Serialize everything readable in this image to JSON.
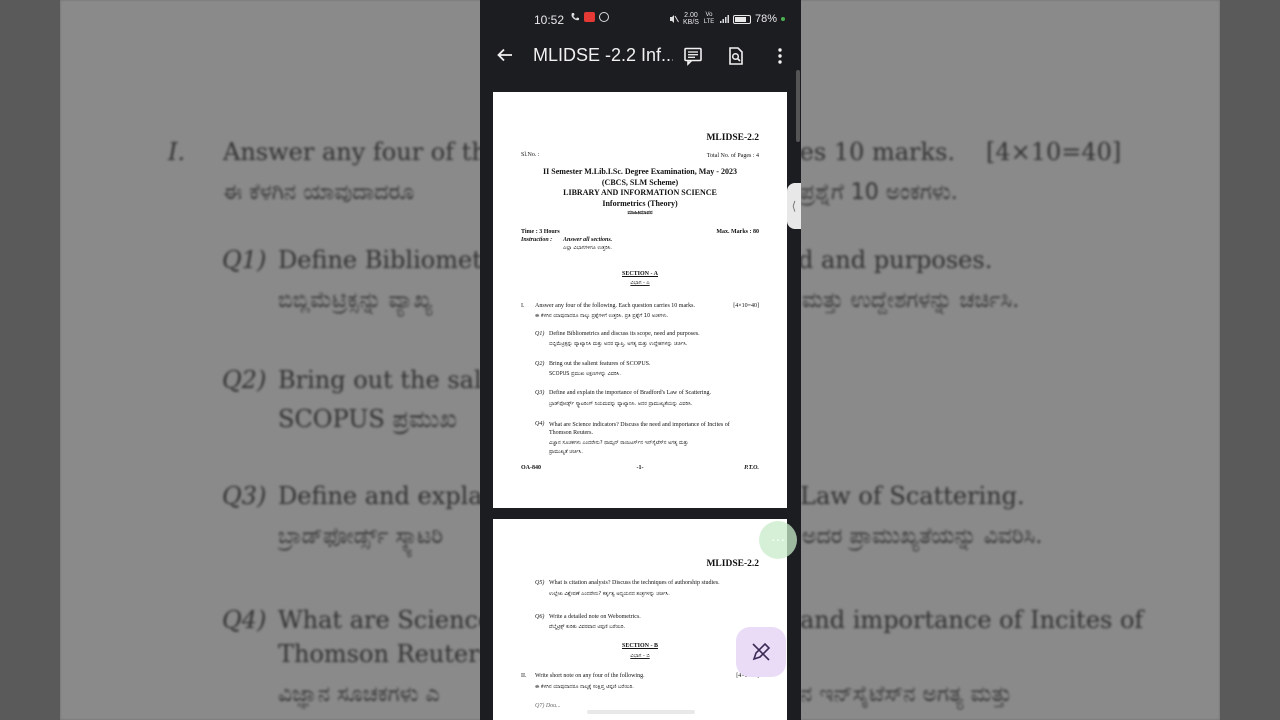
{
  "background": {
    "lines": [
      {
        "text": "I.",
        "kind": "q"
      },
      {
        "text": "Answer any four of the",
        "kind": "en"
      },
      {
        "text": "ies 10 marks.",
        "kind": "en"
      },
      {
        "text": "[4×10=40]",
        "kind": "en"
      },
      {
        "text": "ಈ ಕೆಳಗಿನ ಯಾವುದಾದರೂ",
        "kind": "kn"
      },
      {
        "text": "ಪ್ರಶ್ನೆಗೆ 10 ಅಂಕಗಳು.",
        "kind": "kn"
      },
      {
        "text": "Q1)",
        "kind": "q"
      },
      {
        "text": "Define Bibliometr",
        "kind": "en"
      },
      {
        "text": "d and purposes.",
        "kind": "en"
      },
      {
        "text": "ಬಿಬ್ಲಿಮೆಟ್ರಿಕ್ಸನ್ನು ವ್ಯಾಖ್ಯ",
        "kind": "kn"
      },
      {
        "text": "ಮತ್ತು ಉದ್ದೇಶಗಳನ್ನು ಚರ್ಚಿಸಿ.",
        "kind": "kn"
      },
      {
        "text": "Q2)",
        "kind": "q"
      },
      {
        "text": "Bring out the salie",
        "kind": "en"
      },
      {
        "text": "SCOPUS ಪ್ರಮುಖ",
        "kind": "en"
      },
      {
        "text": "Q3)",
        "kind": "q"
      },
      {
        "text": "Define and explai",
        "kind": "en"
      },
      {
        "text": "Law of Scattering.",
        "kind": "en"
      },
      {
        "text": "ಬ್ರಾಡ್‌ಫೋರ್ಡ್ಸ್ ಸ್ಕ್ಯಾಟರಿ",
        "kind": "kn"
      },
      {
        "text": "ಅದರ ಪ್ರಾಮುಖ್ಯತೆಯನ್ನು ವಿವರಿಸಿ.",
        "kind": "kn"
      },
      {
        "text": "Q4)",
        "kind": "q"
      },
      {
        "text": "What are Science",
        "kind": "en"
      },
      {
        "text": "and importance of Incites of",
        "kind": "en"
      },
      {
        "text": "Thomson Reuters.",
        "kind": "en"
      },
      {
        "text": "ವಿಜ್ಞಾನ ಸೂಚಕಗಳು ಎ",
        "kind": "kn"
      },
      {
        "text": "ನ ಇನ್‌ಸೈಟೆಸ್‌ನ ಅಗತ್ಯ ಮತ್ತು",
        "kind": "kn"
      }
    ]
  },
  "status_bar": {
    "time": "10:52",
    "speed_top": "2.00",
    "speed_bottom": "KB/S",
    "network": "Vo LTE",
    "battery": "78%",
    "battery_level": 0.78
  },
  "app_bar": {
    "title": "MLIDSE -2.2 Inf...",
    "back_icon": "arrow-back-icon",
    "comment_icon": "comment-icon",
    "search_icon": "find-in-page-icon",
    "menu_icon": "more-vert-icon"
  },
  "page1": {
    "code": "MLIDSE-2.2",
    "sl_no": "Sl.No. :",
    "total_pages": "Total No. of Pages : 4",
    "exam_line": "II Semester M.Lib.I.Sc. Degree Examination, May - 2023",
    "scheme": "(CBCS, SLM Scheme)",
    "subject": "LIBRARY AND INFORMATION SCIENCE",
    "paper": "Informetrics (Theory)",
    "paper_kn": "ಮಾಹಿತಿಮಾಪನ",
    "time": "Time : 3 Hours",
    "max_marks": "Max. Marks : 80",
    "instruction_label": "Instruction :",
    "instruction": "Answer all sections.",
    "instruction_kn": "ಎಲ್ಲಾ ವಿಭಾಗಗಳಿಗೂ ಉತ್ತರಿಸಿ.",
    "section_a": "SECTION - A",
    "section_a_kn": "ವಿಭಾಗ - ಎ",
    "part_no": "I.",
    "part_text": "Answer any four of the following. Each question carries 10 marks.",
    "part_marks": "[4×10=40]",
    "part_kn": "ಈ ಕೆಳಗಿನ ಯಾವುದಾದರೂ ನಾಲ್ಕು ಪ್ರಶ್ನೆಗಳಿಗೆ ಉತ್ತರಿಸಿ. ಪ್ರತಿ ಪ್ರಶ್ನೆಗೆ 10 ಅಂಕಗಳು.",
    "questions": [
      {
        "no": "Q1)",
        "text": "Define Bibliometrics and discuss its scope, need and purposes.",
        "text2": "",
        "kn": "ಬಿಬ್ಲಿಮೆಟ್ರಿಕ್ಸನ್ನು ವ್ಯಾಖ್ಯಾನಿಸಿ ಮತ್ತು ಅದರ ವ್ಯಾಪ್ತಿ, ಅಗತ್ಯ ಮತ್ತು ಉದ್ದೇಶಗಳನ್ನು ಚರ್ಚಿಸಿ.",
        "kn2": ""
      },
      {
        "no": "Q2)",
        "text": "Bring out the salient features of SCOPUS.",
        "text2": "",
        "kn": "SCOPUS ಪ್ರಮುಖ ಲಕ್ಷಣಗಳನ್ನು ವಿವರಿಸಿ.",
        "kn2": ""
      },
      {
        "no": "Q3)",
        "text": "Define and explain the importance of Bradford's Law of Scattering.",
        "text2": "",
        "kn": "ಬ್ರಾಡ್‌ಫೋರ್ಡ್ಸ್ ಸ್ಕ್ಯಾಟರಿಂಗ್ ನಿಯಮವನ್ನು ವ್ಯಾಖ್ಯಾನಿಸಿ. ಅದರ ಪ್ರಾಮುಖ್ಯತೆಯನ್ನು ವಿವರಿಸಿ.",
        "kn2": ""
      },
      {
        "no": "Q4)",
        "text": "What are Science indicators? Discuss the need and importance of Incites of",
        "text2": "Thomson Reuters.",
        "kn": "ವಿಜ್ಞಾನ ಸೂಚಕಗಳು ಎಂದರೇನು? ಥಾಮ್ಸನ್ ರಾಯಿಟರ್ಸ್‌ನ ಇನ್‌ಸೈಟೆಸ್‌ನ ಅಗತ್ಯ ಮತ್ತು",
        "kn2": "ಪ್ರಾಮುಖ್ಯತೆ ಚರ್ಚಿಸಿ."
      }
    ],
    "footer_left": "OA-840",
    "footer_center": "-1-",
    "footer_right": "P.T.O."
  },
  "page2": {
    "code": "MLIDSE-2.2",
    "questions": [
      {
        "no": "Q5)",
        "text": "What is citation analysis? Discuss the techniques of authorship studies.",
        "kn": "ಉಲ್ಲೇಖ ವಿಶ್ಲೇಷಣೆ ಎಂದರೇನು? ಕರ್ತೃತ್ವ ಅಧ್ಯಯನದ ತಂತ್ರಗಳನ್ನು ಚರ್ಚಿಸಿ."
      },
      {
        "no": "Q6)",
        "text": "Write a detailed note on Webometrics.",
        "kn": "ವೆಬ್ಮೆಟ್ರಿಕ್ಸ್ ಕುರಿತು ವಿವರವಾದ ಟಿಪ್ಪಣಿ ಬರೆಯಿರಿ."
      }
    ],
    "section_b": "SECTION - B",
    "section_b_kn": "ವಿಭಾಗ - ಬಿ",
    "part_no": "II.",
    "part_text": "Write short note on any four of the following.",
    "part_marks": "[4×5=20]",
    "part_kn": "ಈ ಕೆಳಗಿನ ಯಾವುದಾದರೂ ನಾಲ್ಕಕ್ಕೆ ಸಂಕ್ಷಿಪ್ತ ಟಿಪ್ಪಣಿ ಬರೆಯಿರಿ.",
    "q7": "Q7) Dou..."
  },
  "fab": {
    "more_icon": "more-horiz-icon",
    "edit_icon": "edit-pen-icon"
  }
}
